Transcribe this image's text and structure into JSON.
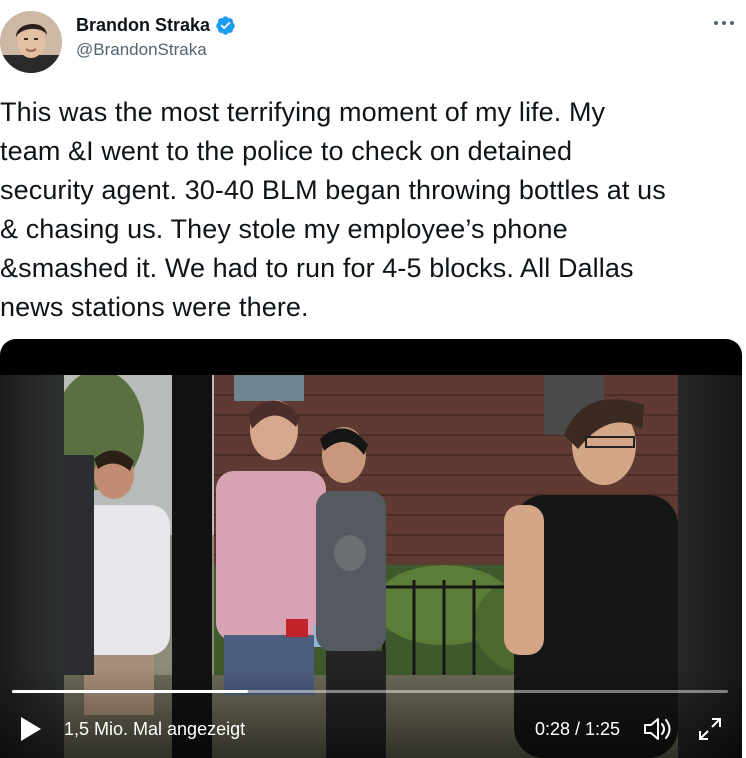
{
  "author": {
    "display_name": "Brandon Straka",
    "handle": "@BrandonStraka",
    "verified_icon": "verified-badge-icon",
    "avatar": "avatar"
  },
  "more_icon": "more-horizontal-icon",
  "tweet": {
    "text": "This was the most terrifying moment of my life. My\nteam &I went to the police to check on detained\nsecurity agent. 30-40 BLM began throwing bottles at us\n& chasing us. They stole my employee’s phone\n&smashed it. We had to run for 4-5 blocks. All Dallas\nnews stations were there."
  },
  "video": {
    "views": "1,5 Mio. Mal angezeigt",
    "time": "0:28 / 1:25",
    "progress": 0.33,
    "icons": {
      "play": "play-icon",
      "volume": "volume-icon",
      "fullscreen": "fullscreen-icon"
    }
  },
  "colors": {
    "verified": "#1d9bf0",
    "handle": "#536471",
    "text": "#0f1419"
  }
}
